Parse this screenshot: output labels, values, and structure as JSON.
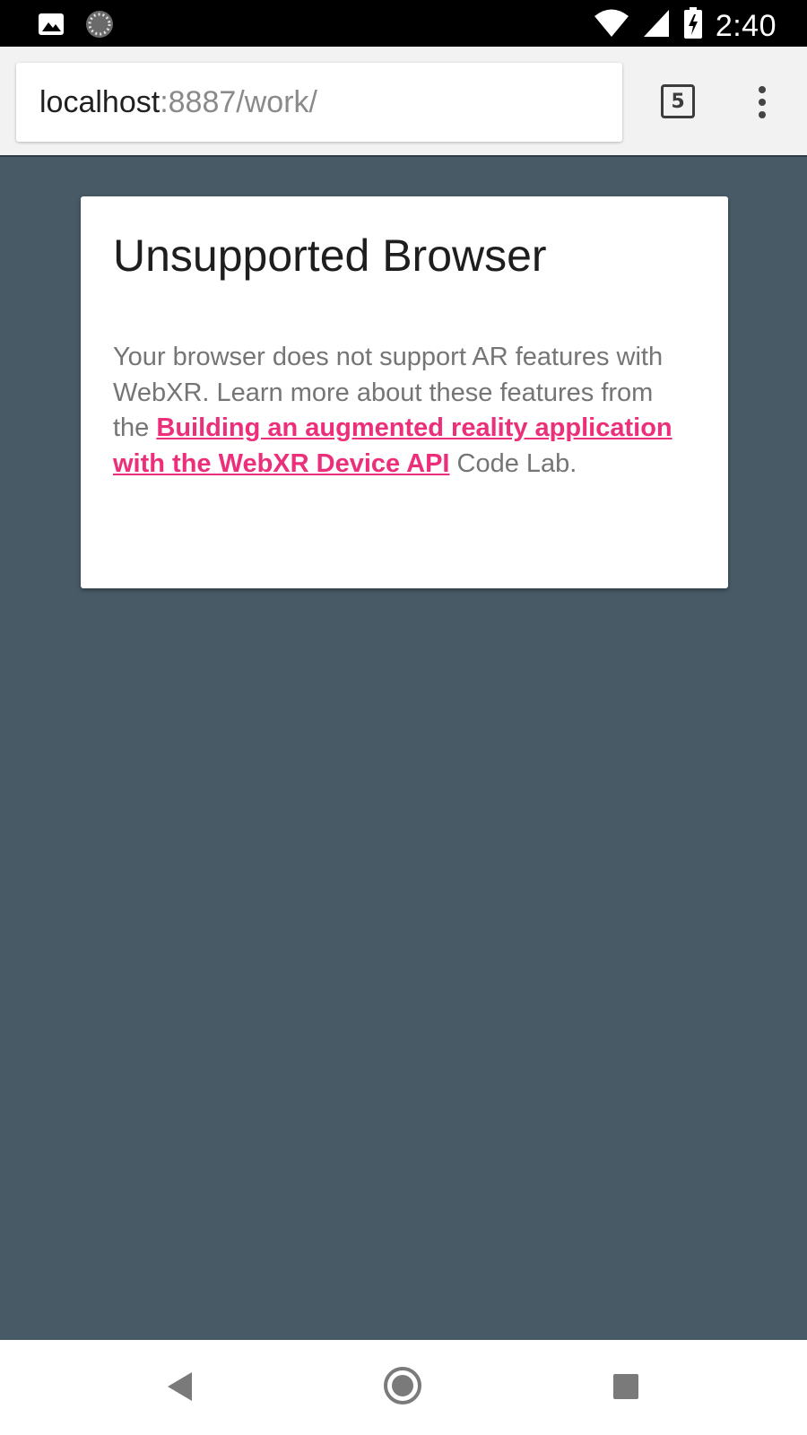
{
  "status_bar": {
    "time": "2:40",
    "icons_left": [
      "image-notification-icon",
      "loading-spinner-icon"
    ],
    "icons_right": [
      "wifi-icon",
      "cell-signal-icon",
      "battery-charging-icon"
    ]
  },
  "browser": {
    "url_host": "localhost",
    "url_rest": ":8887/work/",
    "tab_count": "5"
  },
  "card": {
    "title": "Unsupported Browser",
    "body_before": "Your browser does not support AR features with WebXR. Learn more about these features from the ",
    "link_text": "Building an augmented reality application with the WebXR Device API",
    "body_after": " Code Lab."
  },
  "nav_bar": {
    "icons": [
      "back-icon",
      "home-icon",
      "recents-icon"
    ]
  },
  "colors": {
    "page_background": "#475a66",
    "link": "#ec2f7b",
    "status_bar": "#000000",
    "toolbar": "#f2f2f2"
  }
}
